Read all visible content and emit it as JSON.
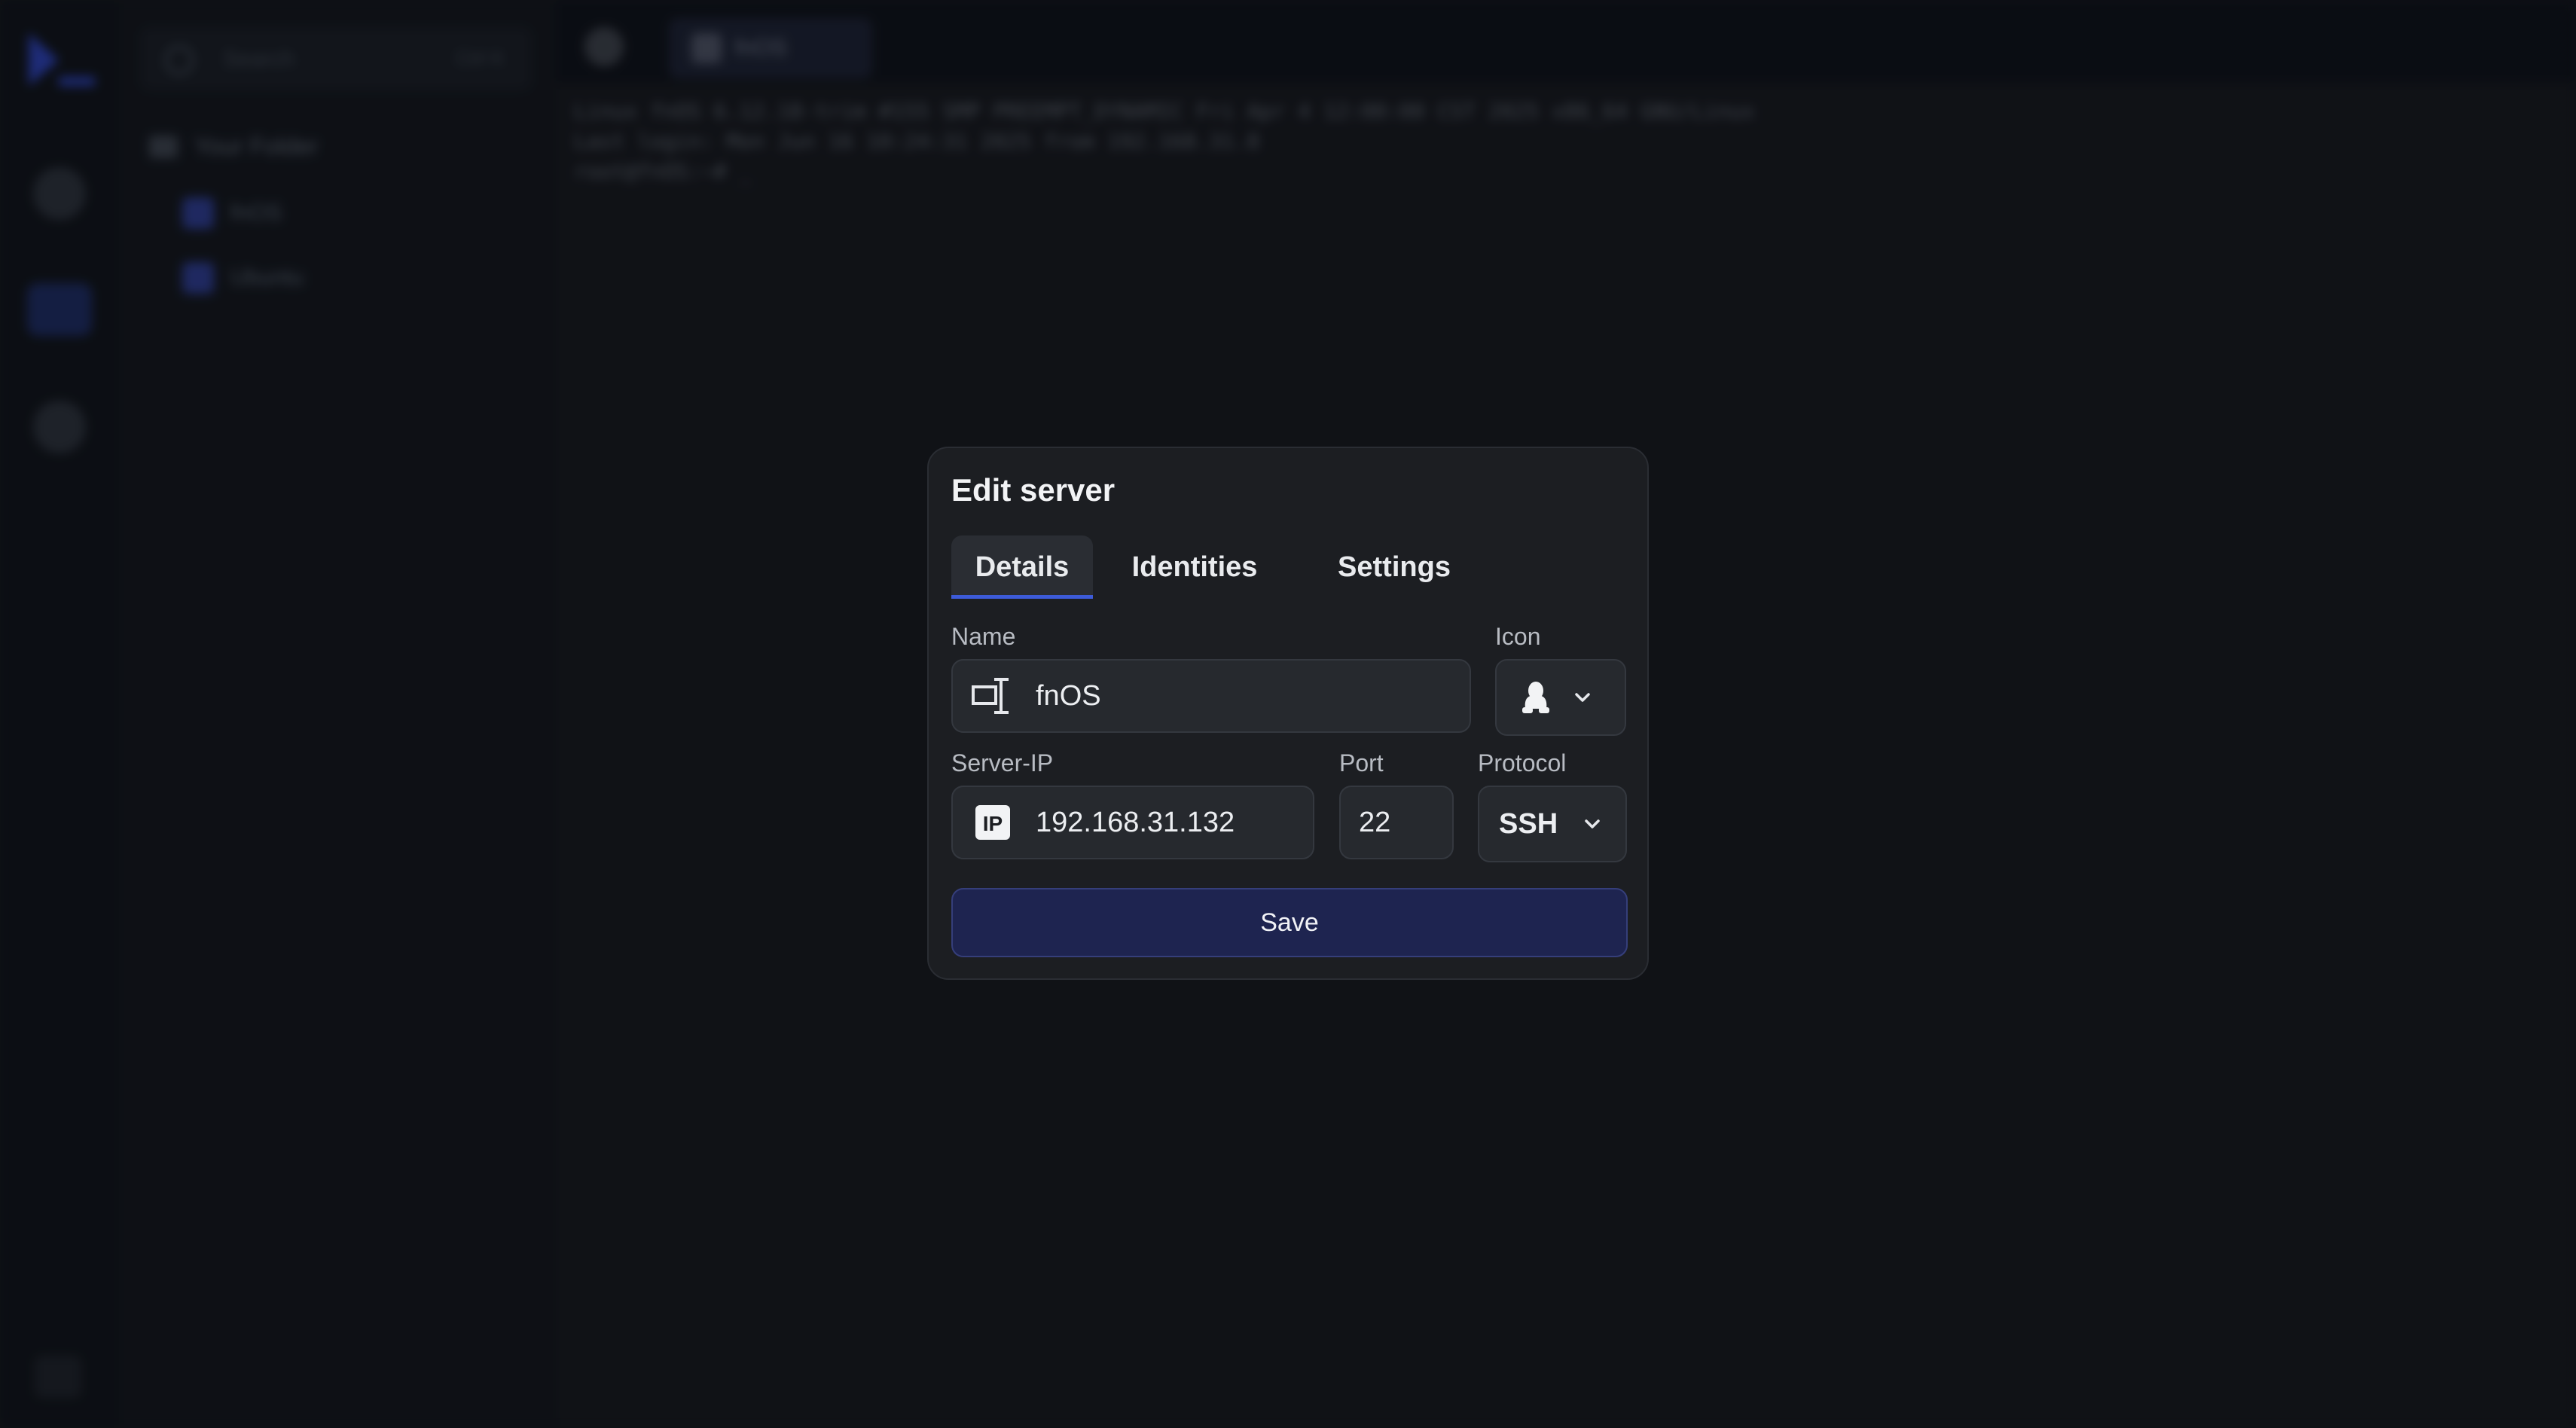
{
  "background": {
    "search_placeholder": "Search",
    "search_shortcut": "Ctrl K",
    "folder_label": "Your Folder",
    "servers": [
      "fnOS",
      "Ubuntu"
    ],
    "tab_label": "fnOS",
    "terminal_lines": [
      "Linux fnOS 6.12.18-trim #155 SMP PREEMPT_DYNAMIC Fri Apr 4 12:00:00 CST 2025 x86_64 GNU/Linux",
      "Last login: Mon Jun 16 10:24:31 2025 from 192.168.31.8",
      "root@fnOS:~# _"
    ]
  },
  "dialog": {
    "title": "Edit server",
    "tabs": [
      {
        "label": "Details",
        "active": true
      },
      {
        "label": "Identities",
        "active": false
      },
      {
        "label": "Settings",
        "active": false
      }
    ],
    "name": {
      "label": "Name",
      "value": "fnOS",
      "icon": "server-icon"
    },
    "icon_select": {
      "label": "Icon",
      "value": "linux-tux-icon"
    },
    "server_ip": {
      "label": "Server-IP",
      "value": "192.168.31.132",
      "icon": "ip-icon"
    },
    "port": {
      "label": "Port",
      "value": "22"
    },
    "protocol": {
      "label": "Protocol",
      "value": "SSH"
    },
    "save_label": "Save"
  },
  "colors": {
    "accent": "#3d5bd9",
    "save_bg": "#1e2450",
    "dialog_bg": "#1c1e22",
    "field_bg": "#26292e"
  }
}
